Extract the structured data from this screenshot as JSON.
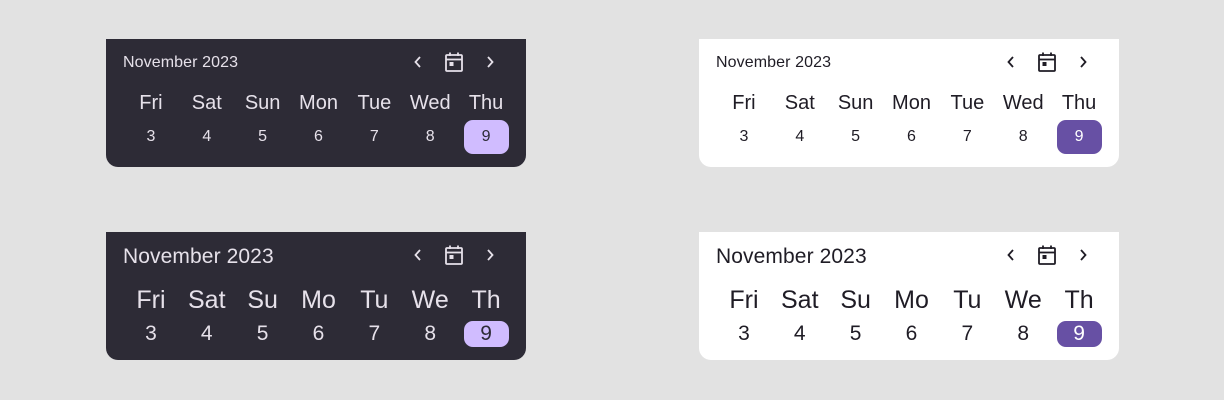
{
  "calendars": [
    {
      "title": "November 2023",
      "weekdays": [
        "Fri",
        "Sat",
        "Sun",
        "Mon",
        "Tue",
        "Wed",
        "Thu"
      ],
      "dates": [
        "3",
        "4",
        "5",
        "6",
        "7",
        "8",
        "9"
      ],
      "selected_date": "9"
    },
    {
      "title": "November 2023",
      "weekdays": [
        "Fri",
        "Sat",
        "Sun",
        "Mon",
        "Tue",
        "Wed",
        "Thu"
      ],
      "dates": [
        "3",
        "4",
        "5",
        "6",
        "7",
        "8",
        "9"
      ],
      "selected_date": "9"
    },
    {
      "title": "November 2023",
      "weekdays": [
        "Fri",
        "Sat",
        "Su",
        "Mo",
        "Tu",
        "We",
        "Th"
      ],
      "dates": [
        "3",
        "4",
        "5",
        "6",
        "7",
        "8",
        "9"
      ],
      "selected_date": "9"
    },
    {
      "title": "November 2023",
      "weekdays": [
        "Fri",
        "Sat",
        "Su",
        "Mo",
        "Tu",
        "We",
        "Th"
      ],
      "dates": [
        "3",
        "4",
        "5",
        "6",
        "7",
        "8",
        "9"
      ],
      "selected_date": "9"
    }
  ],
  "icons": {
    "prev": "chevron-left-icon",
    "calendar": "calendar-today-icon",
    "next": "chevron-right-icon"
  },
  "colors": {
    "background": "#e2e2e2",
    "dark_surface": "#2d2b36",
    "light_surface": "#ffffff",
    "dark_selected": "#d0bcff",
    "light_selected": "#6750a4"
  }
}
